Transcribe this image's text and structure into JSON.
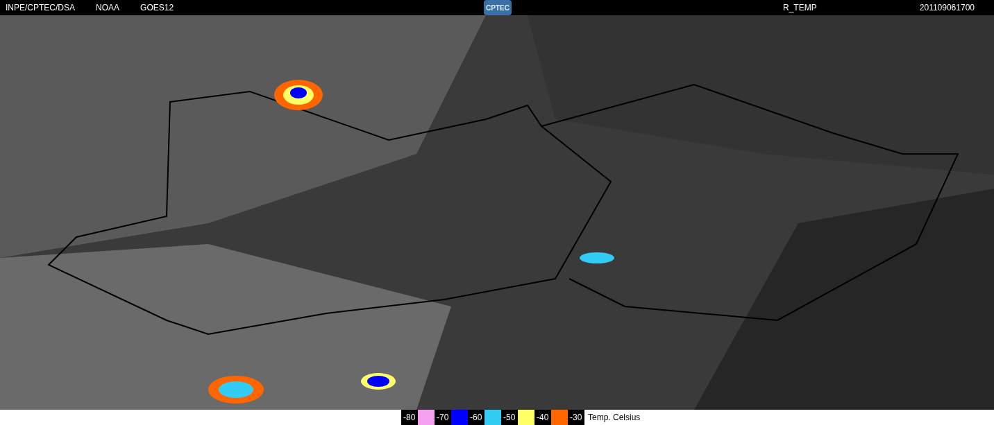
{
  "header": {
    "items": [
      "INPE/CPTEC/DSA",
      "NOAA",
      "GOES12"
    ],
    "logo": "CPTEC",
    "product": "R_TEMP",
    "timestamp": "201109061700"
  },
  "legend": {
    "entries": [
      {
        "label": "-80",
        "color": "#f5a0f0"
      },
      {
        "label": "-70",
        "color": "#0000ff"
      },
      {
        "label": "-60",
        "color": "#33ccf5"
      },
      {
        "label": "-50",
        "color": "#ffff66"
      },
      {
        "label": "-40",
        "color": "#ff6600"
      },
      {
        "label": "-30"
      }
    ],
    "title": "Temp. Celsius"
  }
}
